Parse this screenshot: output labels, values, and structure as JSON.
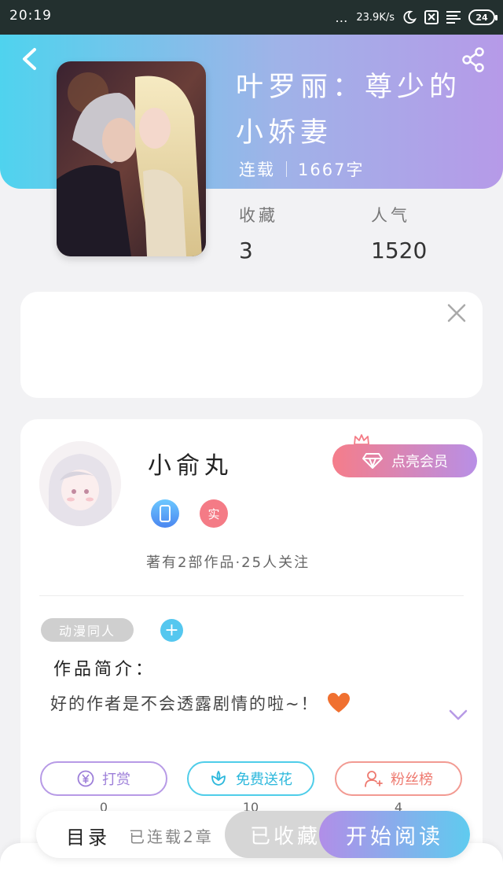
{
  "status_bar": {
    "time": "20:19",
    "network_speed": "23.9K/s",
    "battery": "24"
  },
  "book": {
    "title": "叶罗丽：尊少的小娇妻",
    "status": "连载",
    "word_count": "1667字",
    "stats": [
      {
        "label": "收藏",
        "value": "3"
      },
      {
        "label": "人气",
        "value": "1520"
      }
    ]
  },
  "author": {
    "name": "小俞丸",
    "vip_button": "点亮会员",
    "badge_real": "实",
    "stats_text": "著有2部作品·25人关注"
  },
  "tags": {
    "items": [
      "动漫同人"
    ],
    "add_label": "+"
  },
  "intro": {
    "title": "作品简介：",
    "text": "好的作者是不会透露剧情的啦~！"
  },
  "actions": [
    {
      "label": "打赏",
      "count": "0"
    },
    {
      "label": "免费送花",
      "count": "10"
    },
    {
      "label": "粉丝榜",
      "count": "4"
    }
  ],
  "bottom_bar": {
    "toc_label": "目录",
    "chapters_label": "已连载2章",
    "favorited_label": "已收藏",
    "read_label": "开始阅读"
  },
  "colors": {
    "header_start": "#4fd3ee",
    "header_end": "#b69ae8",
    "vip_start": "#f57d8a",
    "vip_end": "#b88fe6",
    "heart": "#f07030"
  },
  "icons": [
    "back-icon",
    "share-icon",
    "close-icon",
    "crown-icon",
    "diamond-icon",
    "phone-badge-icon",
    "heart-icon",
    "chevron-down-icon",
    "yen-icon",
    "flower-icon",
    "user-icon"
  ]
}
